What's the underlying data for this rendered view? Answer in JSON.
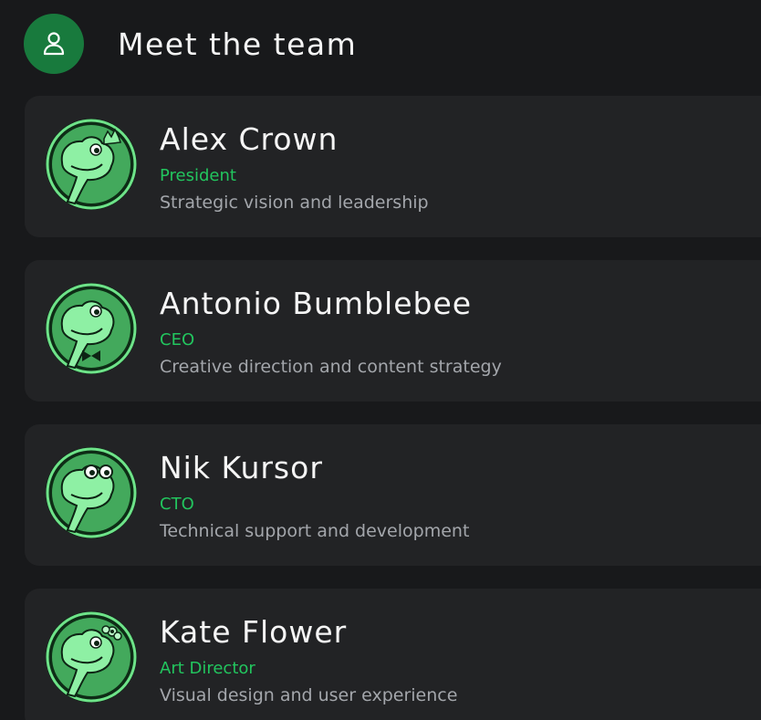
{
  "header": {
    "title": "Meet the team",
    "icon": "user-icon"
  },
  "colors": {
    "background": "#18191b",
    "card": "#222325",
    "accent": "#22c55e",
    "badge": "#187a3d"
  },
  "team": [
    {
      "name": "Alex Crown",
      "role": "President",
      "description": "Strategic vision and leadership",
      "avatar": "frog-crown-avatar"
    },
    {
      "name": "Antonio Bumblebee",
      "role": "CEO",
      "description": "Creative direction and content strategy",
      "avatar": "frog-bowtie-avatar"
    },
    {
      "name": "Nik Kursor",
      "role": "CTO",
      "description": "Technical support and development",
      "avatar": "frog-glasses-avatar"
    },
    {
      "name": "Kate Flower",
      "role": "Art Director",
      "description": "Visual design and user experience",
      "avatar": "frog-flower-avatar"
    }
  ]
}
